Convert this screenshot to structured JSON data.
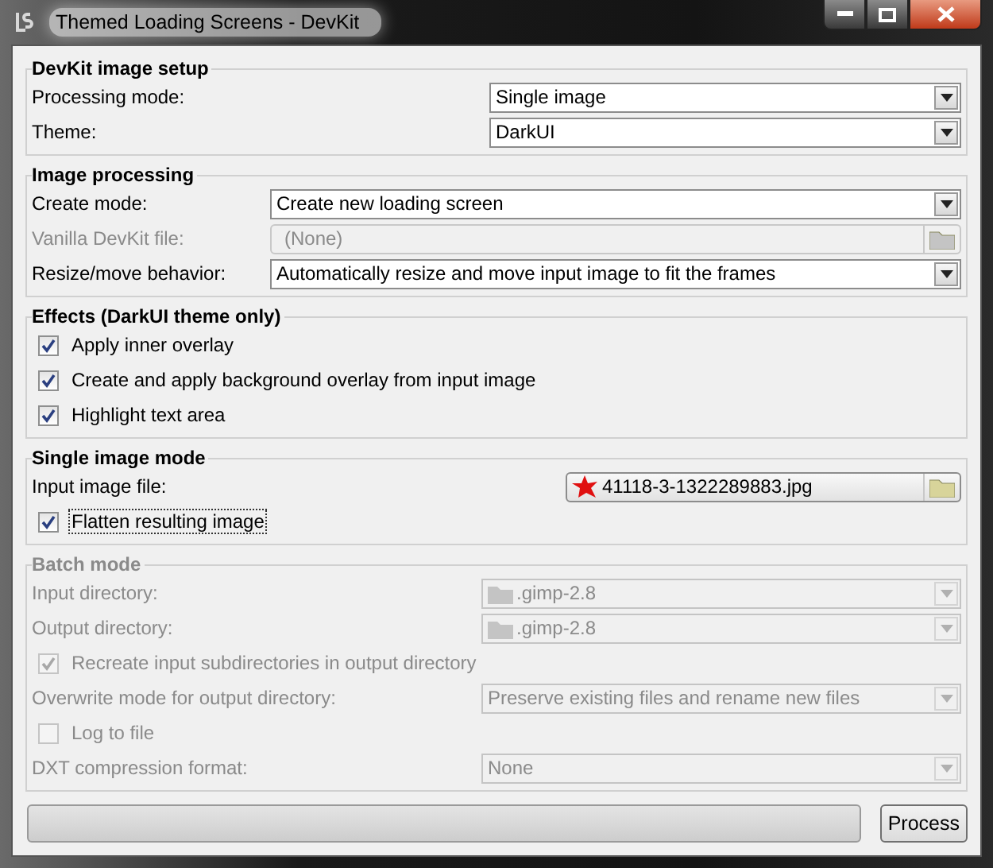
{
  "window": {
    "title": "Themed Loading Screens - DevKit"
  },
  "sections": [
    {
      "title": "DevKit image setup",
      "disabled": false,
      "rows": [
        {
          "kind": "combo",
          "label": "Processing mode:",
          "value": "Single image",
          "disabled": false
        },
        {
          "kind": "combo",
          "label": "Theme:",
          "value": "DarkUI",
          "disabled": false
        }
      ]
    },
    {
      "title": "Image processing",
      "disabled": false,
      "rows": [
        {
          "kind": "combo",
          "label": "Create mode:",
          "value": "Create new loading screen",
          "disabled": false
        },
        {
          "kind": "file",
          "label": "Vanilla DevKit file:",
          "value": "(None)",
          "disabled": true
        },
        {
          "kind": "combo",
          "label": "Resize/move behavior:",
          "value": "Automatically resize and move input image to fit the frames",
          "disabled": false
        }
      ]
    },
    {
      "title": "Effects (DarkUI theme only)",
      "disabled": false,
      "rows": [
        {
          "kind": "checkbox",
          "label": "Apply inner overlay",
          "checked": true,
          "focused": false,
          "disabled": false
        },
        {
          "kind": "checkbox",
          "label": "Create and apply background overlay from input image",
          "checked": true,
          "focused": false,
          "disabled": false
        },
        {
          "kind": "checkbox",
          "label": "Highlight text area",
          "checked": true,
          "focused": false,
          "disabled": false
        }
      ]
    },
    {
      "title": "Single image mode",
      "disabled": false,
      "rows": [
        {
          "kind": "file",
          "label": "Input image file:",
          "value": "41118-3-1322289883.jpg",
          "disabled": false
        },
        {
          "kind": "checkbox",
          "label": "Flatten resulting image",
          "checked": true,
          "focused": true,
          "disabled": false
        }
      ]
    },
    {
      "title": "Batch mode",
      "disabled": true,
      "rows": [
        {
          "kind": "directory",
          "label": "Input directory:",
          "value": ".gimp-2.8",
          "disabled": true
        },
        {
          "kind": "directory",
          "label": "Output directory:",
          "value": ".gimp-2.8",
          "disabled": true
        },
        {
          "kind": "checkbox",
          "label": "Recreate input subdirectories in output directory",
          "checked": true,
          "focused": false,
          "disabled": true
        },
        {
          "kind": "combo",
          "label": "Overwrite mode for output directory:",
          "value": "Preserve existing files and rename new files",
          "disabled": true
        },
        {
          "kind": "checkbox",
          "label": "Log to file",
          "checked": false,
          "focused": false,
          "disabled": true
        },
        {
          "kind": "combo",
          "label": "DXT compression format:",
          "value": "None",
          "disabled": true
        }
      ]
    }
  ],
  "progress": {
    "level": 0
  },
  "buttons": [
    "Process"
  ]
}
